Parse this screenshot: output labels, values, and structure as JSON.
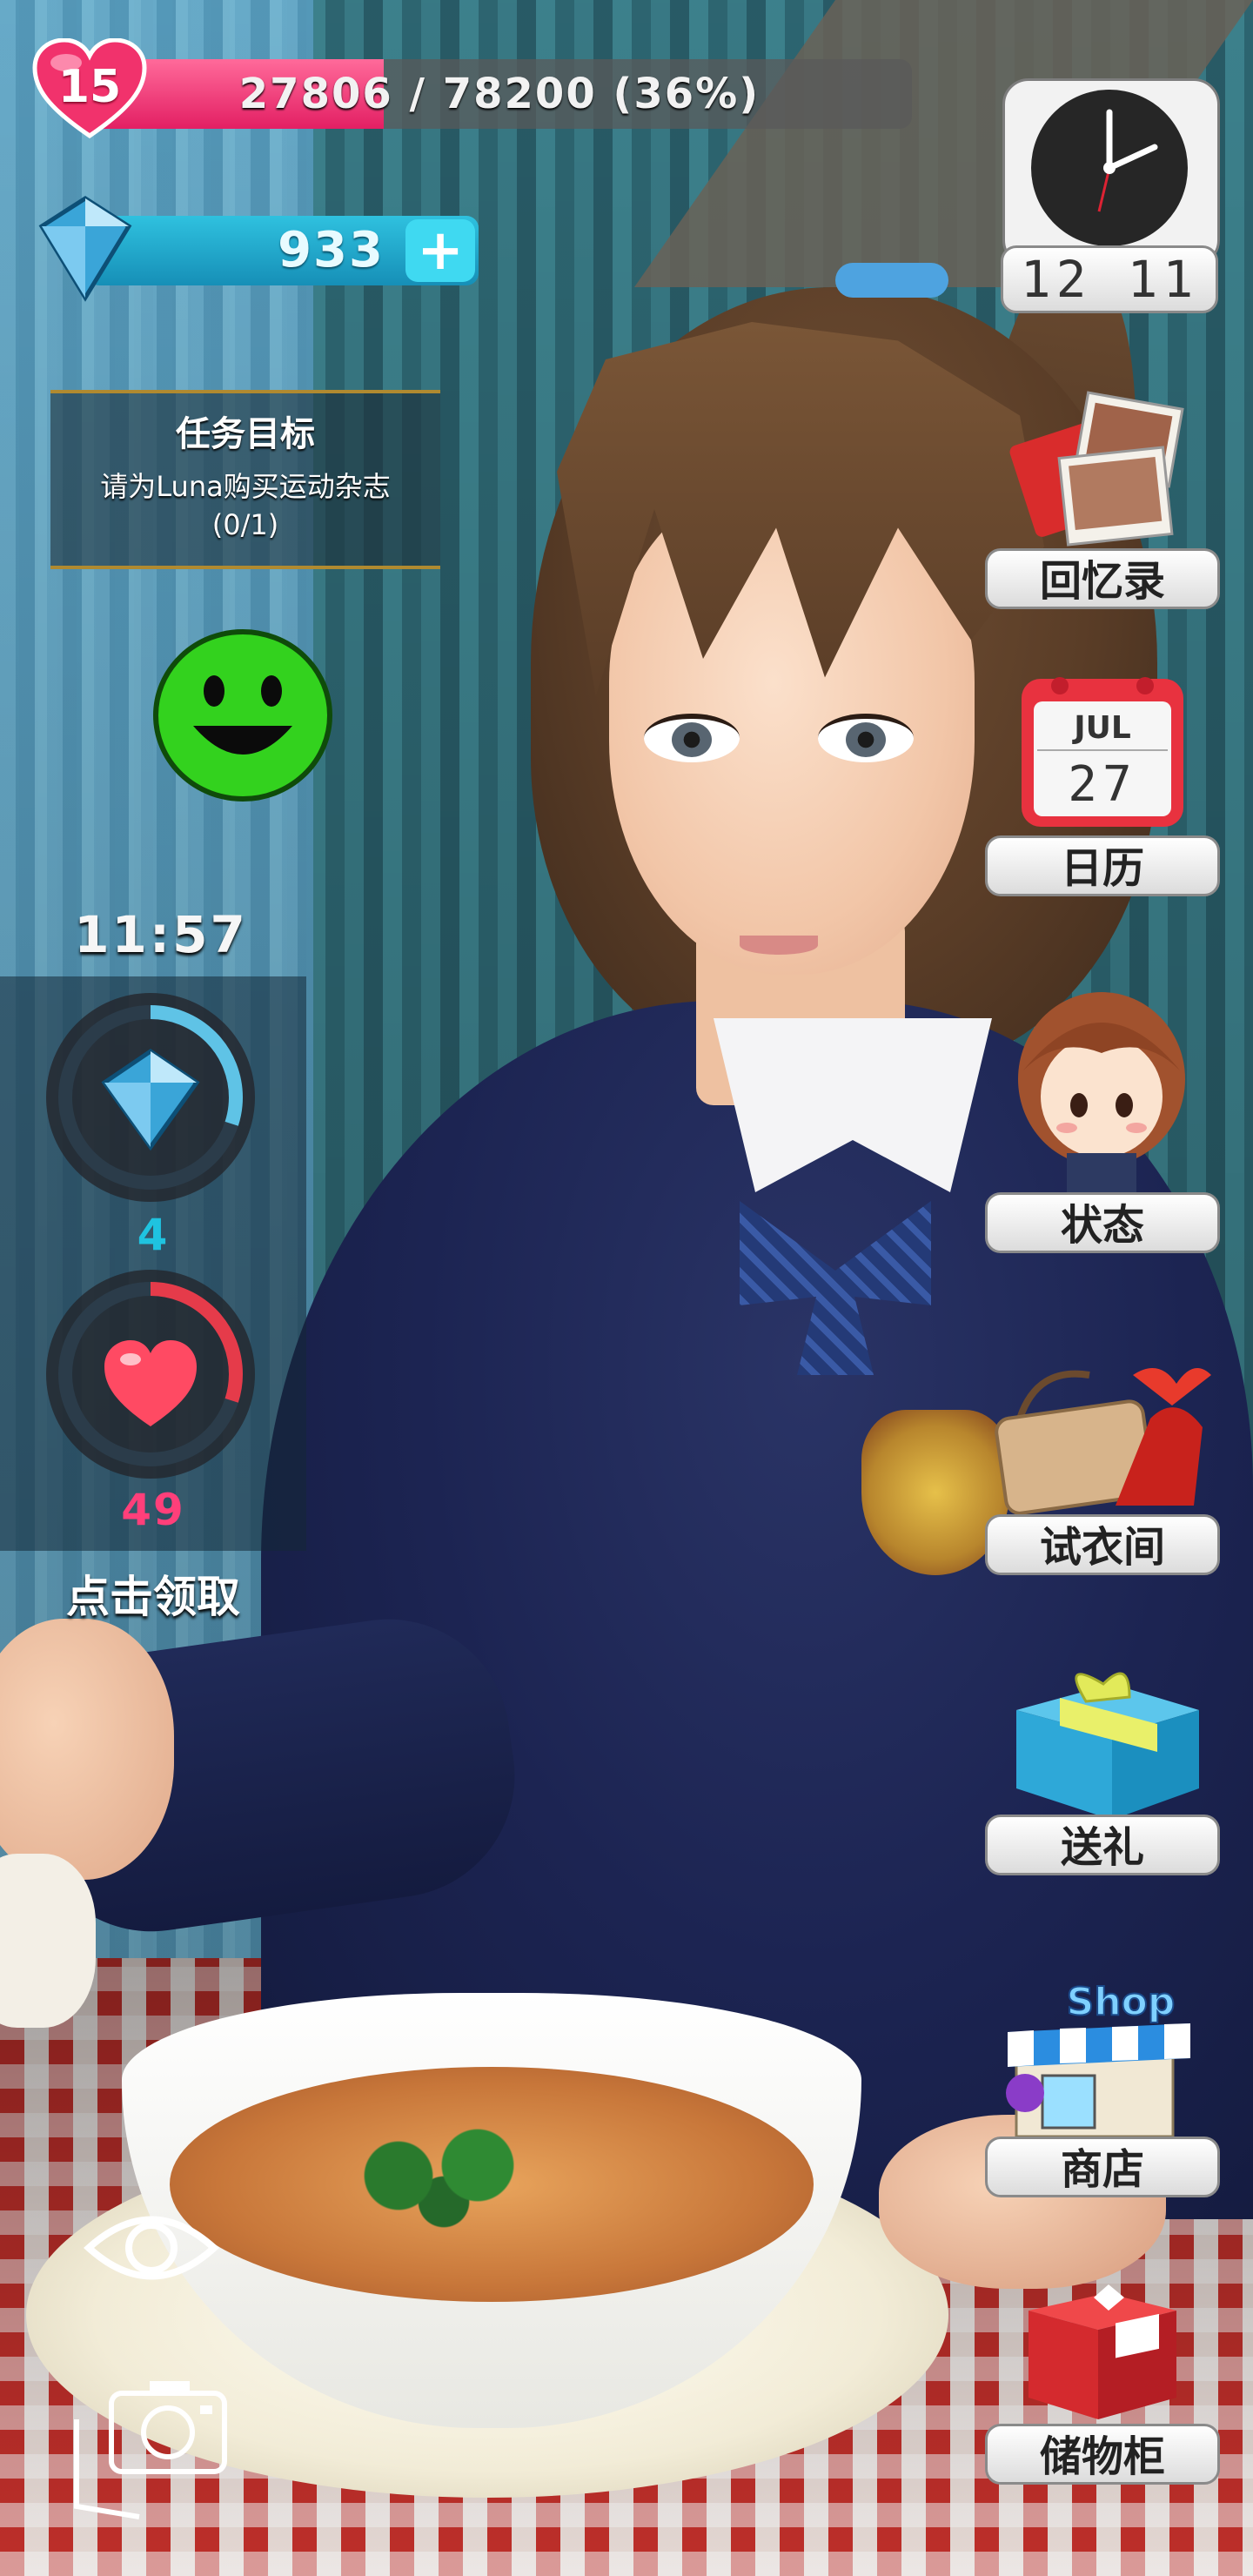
{
  "hud": {
    "level": "15",
    "xp_text": "27806 / 78200 (36%)",
    "xp_progress": 0.36,
    "gems": "933",
    "plus_label": "+",
    "quest": {
      "title": "任务目标",
      "description": "请为Luna购买运动杂志",
      "progress": "(0/1)"
    },
    "mood": "happy",
    "timer": "11:57",
    "gem_reward": "4",
    "heart_reward": "49",
    "gem_ring_progress": 0.3,
    "heart_ring_progress": 0.3,
    "claim_label": "点击领取"
  },
  "menu": {
    "clock_time": "12 11",
    "memories_label": "回忆录",
    "calendar_month": "JUL",
    "calendar_day": "27",
    "calendar_label": "日历",
    "status_label": "状态",
    "dressing_label": "试衣间",
    "gift_label": "送礼",
    "shop_sign": "Shop",
    "shop_label": "商店",
    "storage_label": "储物柜"
  },
  "colors": {
    "xp_fill": "#e31f63",
    "gem_bar": "#1ba6c9",
    "mood_face": "#33d21e",
    "gem_count_text": "#1fc3e0",
    "heart_count_text": "#ff3f7a"
  },
  "icons": [
    "heart-level-icon",
    "diamond-icon",
    "plus-icon",
    "smiley-icon",
    "clock-icon",
    "photos-icon",
    "calendar-icon",
    "chibi-avatar-icon",
    "shoes-bag-icon",
    "gift-box-icon",
    "shop-icon",
    "storage-box-icon",
    "eye-icon",
    "camera-icon"
  ]
}
